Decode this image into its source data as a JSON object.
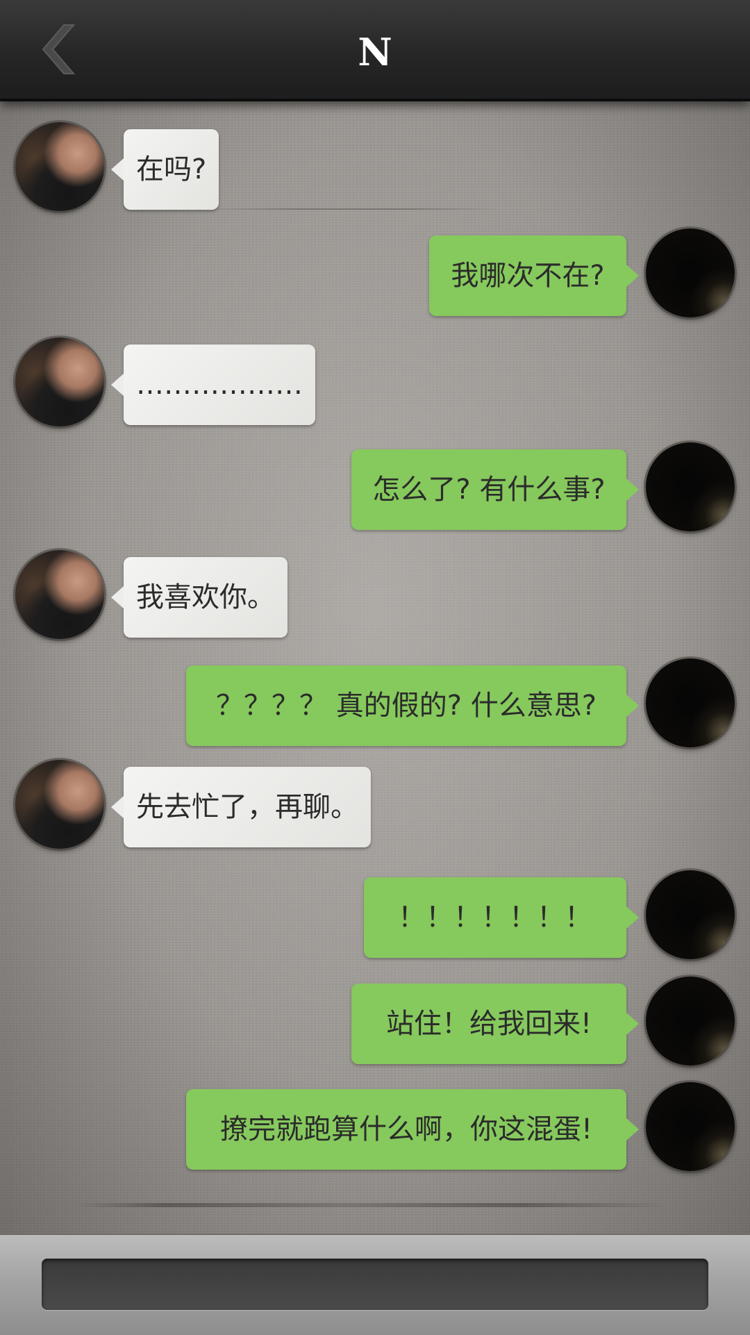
{
  "header": {
    "title": "N",
    "back_icon": "chevron-left-icon"
  },
  "colors": {
    "sent_bubble": "#86c95d",
    "received_bubble": "#ececea",
    "header_bg": "#2a2a2a"
  },
  "messages": [
    {
      "side": "left",
      "text": "在吗?"
    },
    {
      "side": "right",
      "text": "我哪次不在?"
    },
    {
      "side": "left",
      "text": "………………"
    },
    {
      "side": "right",
      "text": "怎么了? 有什么事?"
    },
    {
      "side": "left",
      "text": "我喜欢你。"
    },
    {
      "side": "right",
      "text": "？？？？ 真的假的? 什么意思?"
    },
    {
      "side": "left",
      "text": "先去忙了，再聊。"
    },
    {
      "side": "right",
      "text": "！！！！！！！"
    },
    {
      "side": "right",
      "text": "站住！给我回来!"
    },
    {
      "side": "right",
      "text": "撩完就跑算什么啊，你这混蛋!"
    }
  ],
  "input": {
    "value": "",
    "placeholder": ""
  }
}
